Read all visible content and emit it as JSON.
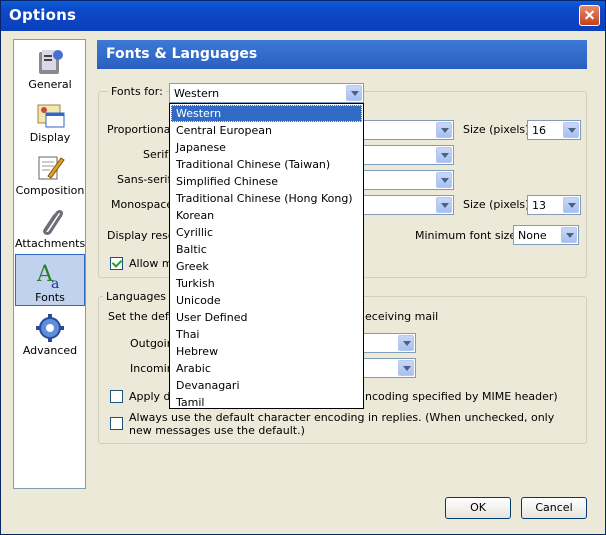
{
  "window": {
    "title": "Options"
  },
  "sidebar": {
    "items": [
      {
        "label": "General",
        "icon": "general-icon"
      },
      {
        "label": "Display",
        "icon": "display-icon"
      },
      {
        "label": "Composition",
        "icon": "composition-icon"
      },
      {
        "label": "Attachments",
        "icon": "attachments-icon"
      },
      {
        "label": "Fonts",
        "icon": "fonts-icon",
        "selected": true
      },
      {
        "label": "Advanced",
        "icon": "advanced-icon"
      }
    ]
  },
  "panel": {
    "title": "Fonts & Languages"
  },
  "fonts": {
    "fonts_for_label": "Fonts for:",
    "fonts_for_value": "Western",
    "proportional_label": "Proportional:",
    "serif_label": "Serif:",
    "sans_serif_label": "Sans-serif:",
    "monospace_label": "Monospace:",
    "size_label_1": "Size (pixels)",
    "size_value_1": "16",
    "size_label_2": "Size (pixels)",
    "size_value_2": "13",
    "display_resolution_label": "Display resolu",
    "min_font_label": "Minimum font size:",
    "min_font_value": "None",
    "allow_label": "Allow me"
  },
  "dropdown": {
    "options": [
      "Western",
      "Central European",
      "Japanese",
      "Traditional Chinese (Taiwan)",
      "Simplified Chinese",
      "Traditional Chinese (Hong Kong)",
      "Korean",
      "Cyrillic",
      "Baltic",
      "Greek",
      "Turkish",
      "Unicode",
      "User Defined",
      "Thai",
      "Hebrew",
      "Arabic",
      "Devanagari",
      "Tamil"
    ],
    "selected": "Western"
  },
  "languages": {
    "legend": "Languages",
    "set_default_label": "Set the defa",
    "receiving_label": "eceiving mail",
    "outgoing_label": "Outgoin",
    "incoming_label": "Incomin",
    "apply_label": "Apply de",
    "apply_tail": "ncoding specified by MIME header)",
    "always_label": "Always use the default character encoding in replies. (When unchecked, only new messages use the default.)"
  },
  "buttons": {
    "ok": "OK",
    "cancel": "Cancel"
  },
  "colors": {
    "title_bar": "#0a4fcf",
    "selection": "#316ac5",
    "panel_header": "#3366cc"
  }
}
